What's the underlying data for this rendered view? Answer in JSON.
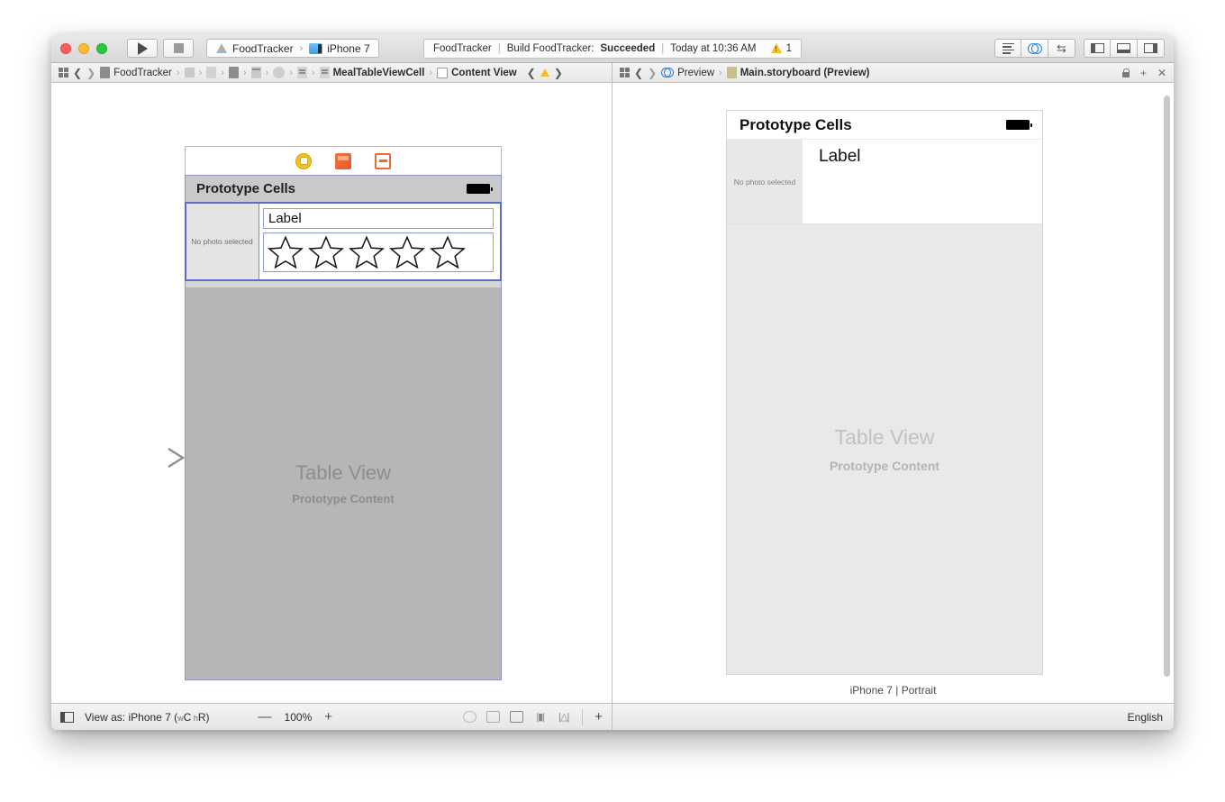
{
  "toolbar": {
    "run_icon": "play-icon",
    "stop_icon": "stop-icon",
    "scheme_project": "FoodTracker",
    "scheme_destination": "iPhone 7",
    "scheme_separator": "›",
    "status": {
      "project": "FoodTracker",
      "action": "Build FoodTracker:",
      "result": "Succeeded",
      "time": "Today at 10:36 AM",
      "warning_count": "1"
    },
    "editor_modes": [
      "standard-editor",
      "assistant-editor",
      "version-editor"
    ],
    "view_toggles": [
      "navigator-toggle",
      "debug-area-toggle",
      "utilities-toggle"
    ]
  },
  "jumpbar_left": {
    "crumbs": [
      {
        "label": "FoodTracker",
        "icon": "project-icon"
      },
      {
        "label": "",
        "icon": "folder-icon"
      },
      {
        "label": "",
        "icon": "file-icon"
      },
      {
        "label": "",
        "icon": "file-dark-icon"
      },
      {
        "label": "",
        "icon": "window-icon"
      },
      {
        "label": "",
        "icon": "circle-icon"
      },
      {
        "label": "",
        "icon": "list-icon"
      },
      {
        "label": "MealTableViewCell",
        "icon": "cell-icon"
      },
      {
        "label": "Content View",
        "icon": "view-icon"
      }
    ],
    "separator": "›",
    "warning_icon": "warning-icon"
  },
  "jumpbar_right": {
    "crumbs": [
      {
        "label": "Preview",
        "icon": "assistant-icon"
      },
      {
        "label": "Main.storyboard (Preview)",
        "icon": "storyboard-icon"
      }
    ],
    "separator": "›",
    "tools": [
      "lock-icon",
      "add-icon",
      "close-icon"
    ],
    "add_label": "+",
    "close_label": "✕"
  },
  "canvas": {
    "scene_dock": [
      "view-controller-icon",
      "first-responder-icon",
      "exit-icon"
    ],
    "status_bar_title": "Prototype Cells",
    "battery_icon": "battery-icon",
    "cell": {
      "photo_placeholder": "No photo selected",
      "name_label": "Label",
      "rating_stars": 5,
      "star_icon": "star-outline-icon"
    },
    "table_view_title": "Table View",
    "table_view_subtitle": "Prototype Content",
    "entry_arrow_icon": "entry-point-arrow-icon"
  },
  "preview": {
    "status_bar_title": "Prototype Cells",
    "battery_icon": "battery-icon",
    "cell": {
      "photo_placeholder": "No photo selected",
      "name_label": "Label"
    },
    "table_view_title": "Table View",
    "table_view_subtitle": "Prototype Content",
    "device_caption": "iPhone 7 | Portrait"
  },
  "bottombar": {
    "panel_toggle_icon": "document-outline-toggle-icon",
    "view_as_prefix": "View as: iPhone 7 (",
    "view_as_width_trait_small": "w",
    "view_as_width_trait": "C",
    "view_as_height_trait_small": "h",
    "view_as_height_trait": "R",
    "view_as_suffix": ")",
    "zoom_out": "—",
    "zoom_value": "100%",
    "zoom_in": "+",
    "autolayout_icons": [
      "update-frames-icon",
      "embed-in-icon",
      "align-icon",
      "pin-icon",
      "resolve-issues-icon"
    ],
    "add_constraint": "+",
    "language": "English"
  }
}
